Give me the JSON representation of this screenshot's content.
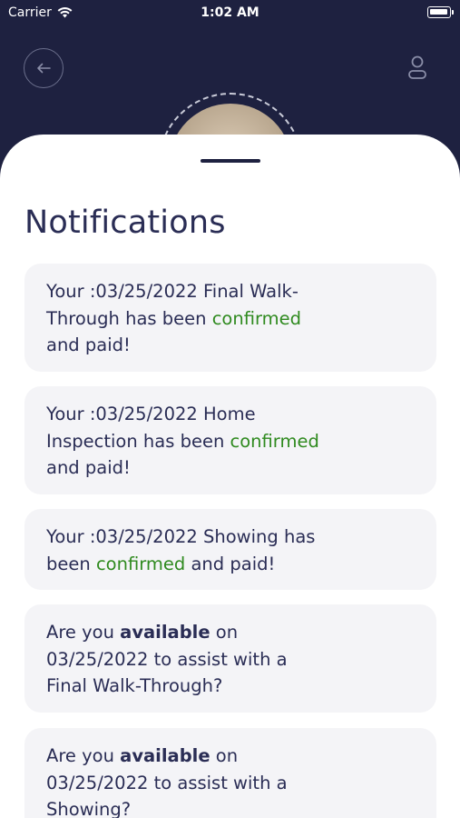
{
  "status_bar": {
    "carrier": "Carrier",
    "time": "1:02 AM"
  },
  "icons": {
    "back": "arrow-left-icon",
    "profile": "user-icon",
    "wifi": "wifi-icon",
    "battery": "battery-icon"
  },
  "colors": {
    "header_bg": "#1e2140",
    "text": "#2a2d55",
    "accent_green": "#2f8a1f",
    "card_bg": "#f4f4f7"
  },
  "page": {
    "title": "Notifications"
  },
  "notifications": [
    {
      "line1": "Your :03/25/2022 Final Walk-",
      "line2a": "Through has been ",
      "line2b": "confirmed",
      "line3": "and paid!"
    },
    {
      "line1": "Your :03/25/2022 Home",
      "line2a": "Inspection has been ",
      "line2b": "confirmed",
      "line3": "and paid!"
    },
    {
      "line1": "Your :03/25/2022 Showing has",
      "line2a": "been ",
      "line2b": "confirmed",
      "line2c": " and paid!"
    },
    {
      "line1a": "Are you ",
      "line1b": "available",
      "line1c": " on",
      "line2": "03/25/2022 to assist with a",
      "line3": "Final Walk-Through?"
    },
    {
      "line1a": "Are you ",
      "line1b": "available",
      "line1c": " on",
      "line2": "03/25/2022 to assist with a",
      "line3": "Showing?"
    }
  ]
}
